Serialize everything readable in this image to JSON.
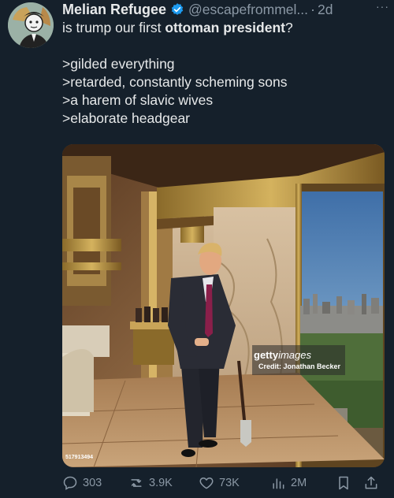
{
  "tweet": {
    "display_name": "Melian Refugee",
    "handle": "@escapefrommel...",
    "separator": "·",
    "time": "2d",
    "more": "···",
    "text_lines": [
      {
        "pre": "is trump our first ",
        "bold": "ottoman president",
        "post": "?"
      },
      ">gilded everything",
      ">retarded, constantly scheming sons",
      ">a harem of slavic wives",
      ">elaborate headgear"
    ]
  },
  "media": {
    "watermark_brand_bold": "getty",
    "watermark_brand_light": "images",
    "watermark_credit": "Credit: Jonathan Becker",
    "image_id": "517913494"
  },
  "actions": {
    "replies": "303",
    "retweets": "3.9K",
    "likes": "73K",
    "views": "2M"
  },
  "colors": {
    "background": "#15202b",
    "text": "#e7e9ea",
    "muted": "#8b98a5",
    "verified": "#1d9bf0"
  }
}
